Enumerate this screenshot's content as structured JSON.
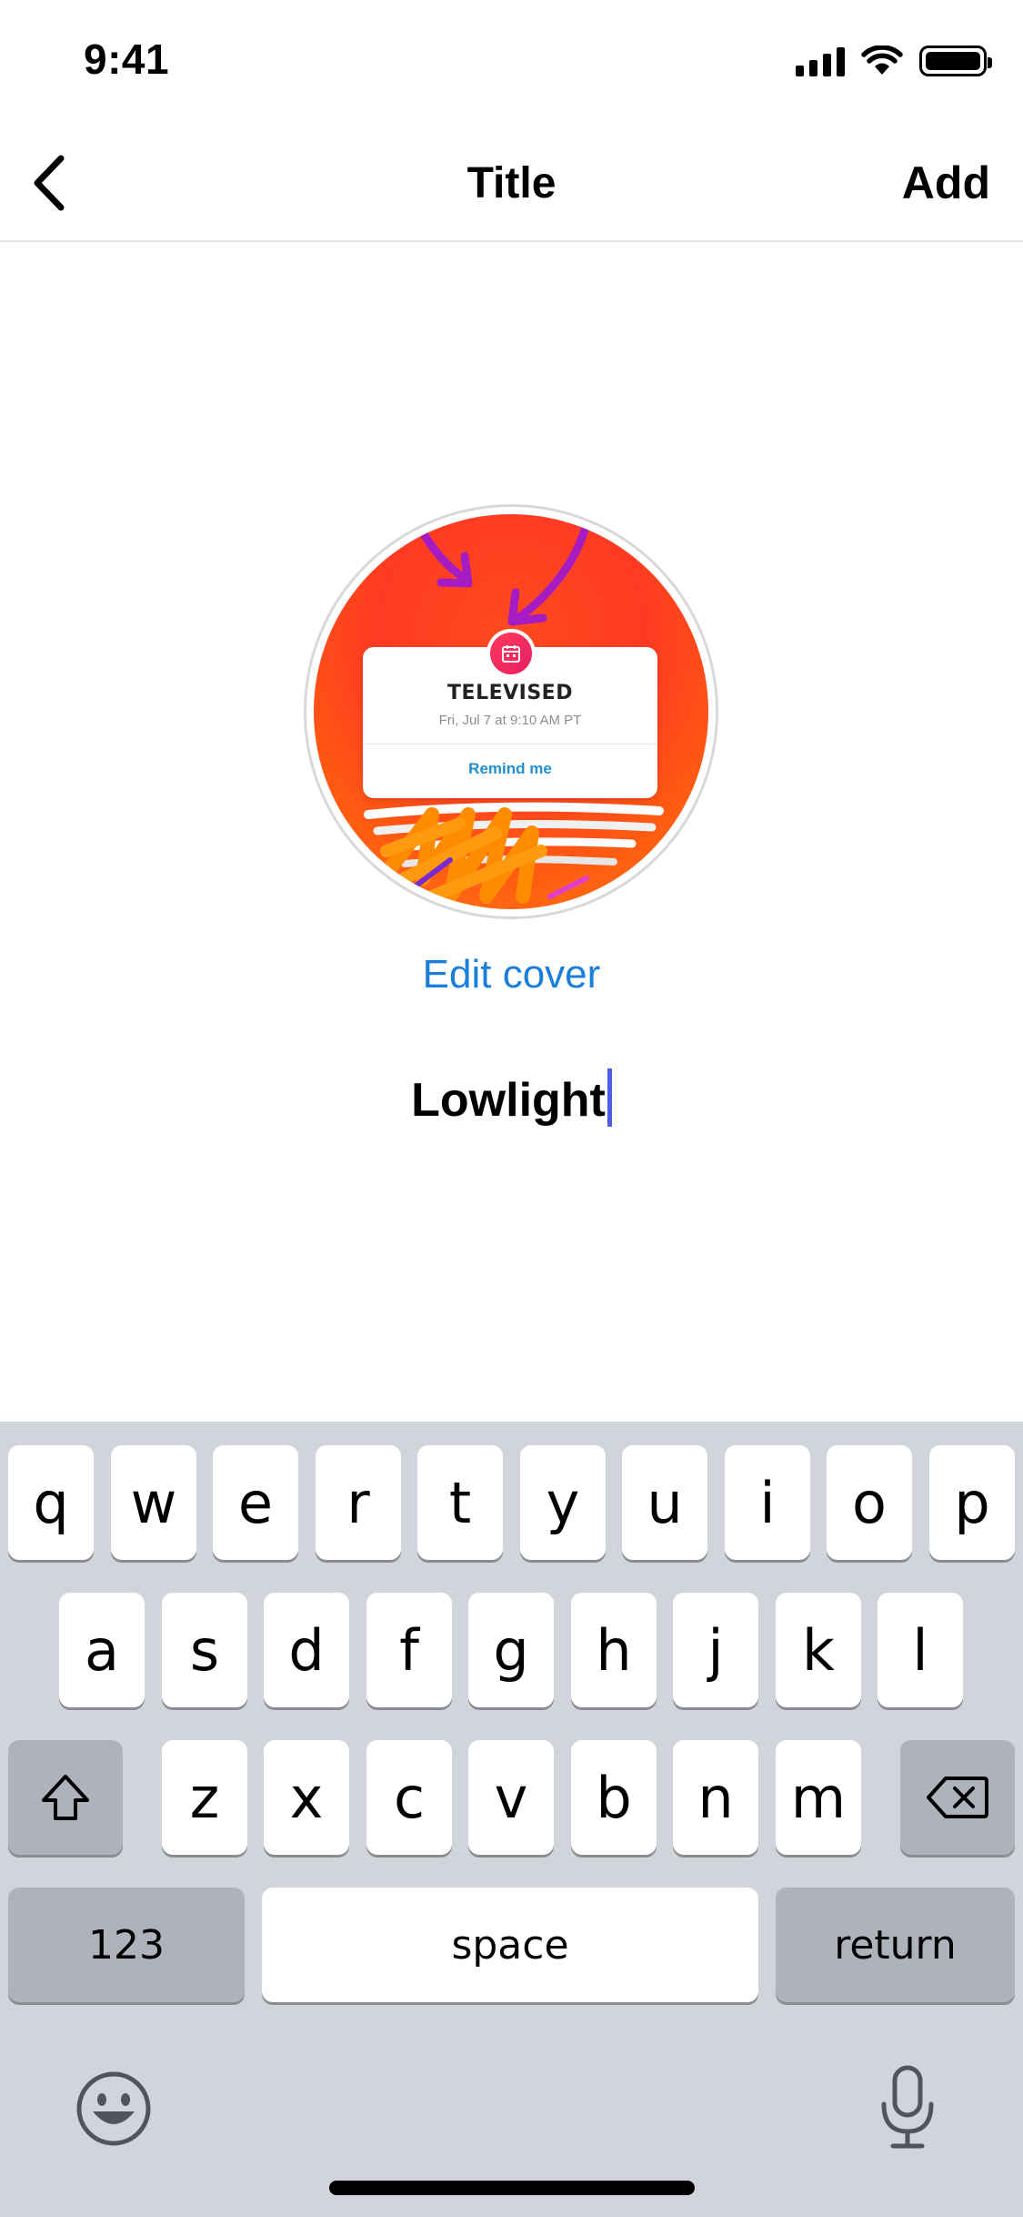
{
  "status_bar": {
    "time": "9:41"
  },
  "nav": {
    "title": "Title",
    "add_label": "Add"
  },
  "cover": {
    "card_title": "TELEVISED",
    "card_subtitle": "Fri, Jul 7 at 9:10 AM PT",
    "card_action": "Remind me",
    "edit_label": "Edit cover"
  },
  "title_input": {
    "value": "Lowlight"
  },
  "keyboard": {
    "row1": [
      "q",
      "w",
      "e",
      "r",
      "t",
      "y",
      "u",
      "i",
      "o",
      "p"
    ],
    "row2": [
      "a",
      "s",
      "d",
      "f",
      "g",
      "h",
      "j",
      "k",
      "l"
    ],
    "row3": [
      "z",
      "x",
      "c",
      "v",
      "b",
      "n",
      "m"
    ],
    "numbers_label": "123",
    "space_label": "space",
    "return_label": "return"
  },
  "colors": {
    "accent": "#1a7fdc",
    "caret": "#4a5ee8",
    "keyboard_bg": "#d1d4db"
  }
}
